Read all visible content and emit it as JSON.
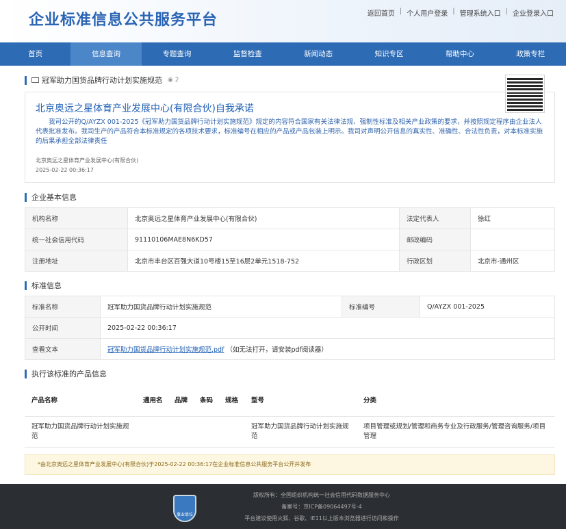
{
  "header": {
    "site_title": "企业标准信息公共服务平台",
    "links": [
      "返回首页",
      "个人用户登录",
      "管理系统入口",
      "企业登录入口"
    ]
  },
  "nav": [
    "首页",
    "信息查询",
    "专题查询",
    "监督检查",
    "新闻动态",
    "知识专区",
    "帮助中心",
    "政策专栏"
  ],
  "breadcrumb": {
    "title": "冠军助力国货品牌行动计划实施规范",
    "views": "2"
  },
  "promise": {
    "title": "北京奥远之星体育产业发展中心(有限合伙)自我承诺",
    "text": "我司公开的Q/AYZX 001-2025《冠军助力国货品牌行动计划实施规范》规定的内容符合国家有关法律法规、强制性标准及相关产业政策的要求，并按照规定程序由企业法人代表批准发布。我司生产的产品符合本标准规定的各项技术要求，标准编号在相应的产品或产品包装上明示。我司对声明公开信息的真实性、准确性、合法性负责，对本标准实施的后果承担全部法律责任",
    "company": "北京奥远之星体育产业发展中心(有限合伙)",
    "date": "2025-02-22 00:36:17"
  },
  "sections": {
    "company_info": "企业基本信息",
    "standard_info": "标准信息",
    "product_info": "执行该标准的产品信息"
  },
  "company": {
    "org_name_label": "机构名称",
    "org_name": "北京奥远之星体育产业发展中心(有限合伙)",
    "legal_rep_label": "法定代表人",
    "legal_rep": "徐红",
    "credit_code_label": "统一社会信用代码",
    "credit_code": "91110106MAE8N6KD57",
    "postcode_label": "邮政编码",
    "postcode": "",
    "address_label": "注册地址",
    "address": "北京市丰台区百强大道10号楼15至16层2单元1518-752",
    "region_label": "行政区划",
    "region": "北京市-通州区"
  },
  "standard": {
    "name_label": "标准名称",
    "name": "冠军助力国货品牌行动计划实施规范",
    "code_label": "标准编号",
    "code": "Q/AYZX 001-2025",
    "pub_time_label": "公开时间",
    "pub_time": "2025-02-22 00:36:17",
    "view_label": "查看文本",
    "file": "冠军助力国货品牌行动计划实施规范.pdf",
    "file_hint": "（如无法打开，请安装pdf阅读器）"
  },
  "products": {
    "headers": [
      "产品名称",
      "通用名",
      "品牌",
      "条码",
      "规格",
      "型号",
      "分类"
    ],
    "rows": [
      [
        "冠军助力国货品牌行动计划实施规范",
        "",
        "",
        "",
        "",
        "冠军助力国货品牌行动计划实施规范",
        "项目管理或规划/管理和商务专业及行政服务/管理咨询服务/项目管理"
      ]
    ]
  },
  "notice": "*由北京奥远之星体育产业发展中心(有限合伙)于2025-02-22 00:36:17在企业标准信息公共服务平台公开并发布",
  "footer": {
    "badge": "事业单位",
    "lines": [
      "版权所有：全国组织机构统一社会信用代码数据服务中心",
      "备案号：京ICP备09064497号-4",
      "平台建议使用火狐、谷歌、IE11以上版本浏览器进行访问和操作"
    ]
  }
}
